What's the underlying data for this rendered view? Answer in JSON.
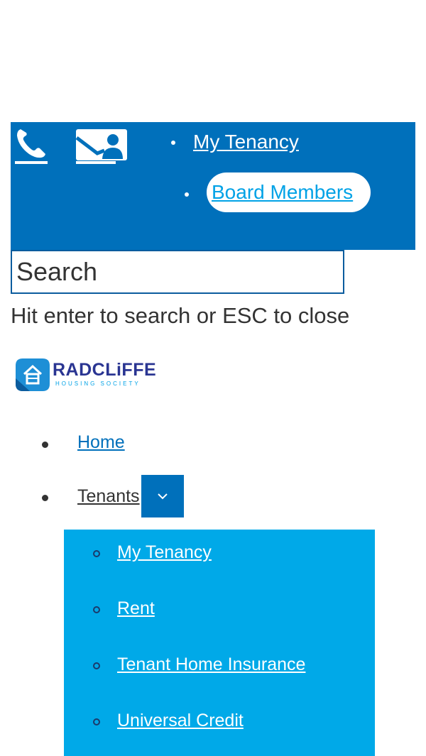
{
  "top_bar": {
    "background_color": "#0070bb",
    "phone_icon": "phone-icon",
    "contact_icon": "envelope-user-icon",
    "menu_items": [
      {
        "label": "My Tenancy"
      },
      {
        "label": "Board Members",
        "highlighted": true
      }
    ]
  },
  "search": {
    "placeholder": "Search",
    "hint": "Hit enter to search or ESC to close"
  },
  "logo": {
    "name": "RADCLiFFE",
    "tagline": "HOUSING SOCIETY",
    "icon": "house-icon"
  },
  "main_nav": {
    "items": [
      {
        "label": "Home"
      },
      {
        "label": "Tenants",
        "has_dropdown": true,
        "dropdown_icon": "chevron-down-icon"
      }
    ]
  },
  "tenants_submenu": {
    "background_color": "#00a9e8",
    "items": [
      {
        "label": "My Tenancy"
      },
      {
        "label": "Rent"
      },
      {
        "label": "Tenant Home Insurance"
      },
      {
        "label": "Universal Credit"
      }
    ]
  }
}
